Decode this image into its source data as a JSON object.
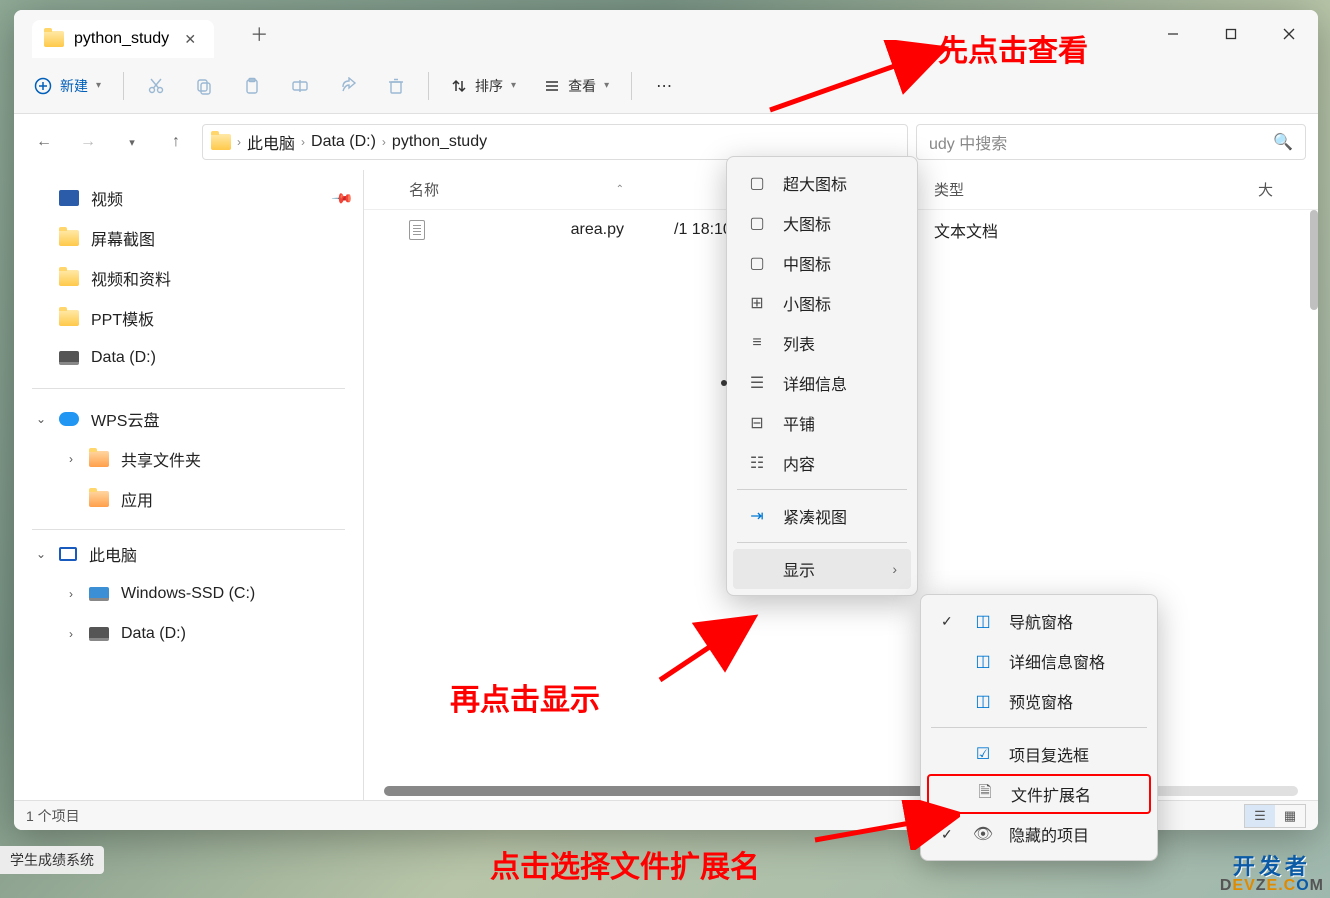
{
  "tab": {
    "title": "python_study"
  },
  "toolbar": {
    "new": "新建",
    "sort": "排序",
    "view": "查看"
  },
  "breadcrumb": {
    "b1": "此电脑",
    "b2": "Data (D:)",
    "b3": "python_study"
  },
  "search": {
    "placeholder": "udy 中搜索"
  },
  "sidebar": {
    "items": [
      "视频",
      "屏幕截图",
      "视频和资料",
      "PPT模板",
      "Data (D:)"
    ],
    "wps": "WPS云盘",
    "wps_items": [
      "共享文件夹",
      "应用"
    ],
    "thispc": "此电脑",
    "drives": [
      "Windows-SSD (C:)",
      "Data (D:)"
    ]
  },
  "columns": {
    "name": "名称",
    "date": "/1 18:10",
    "type_header": "类型",
    "size_header": "大",
    "type": "文本文档"
  },
  "file": {
    "name": "area.py"
  },
  "status": {
    "text": "1 个项目"
  },
  "menu1": {
    "items": [
      "超大图标",
      "大图标",
      "中图标",
      "小图标",
      "列表",
      "详细信息",
      "平铺",
      "内容",
      "紧凑视图",
      "显示"
    ]
  },
  "menu2": {
    "items": [
      "导航窗格",
      "详细信息窗格",
      "预览窗格",
      "项目复选框",
      "文件扩展名",
      "隐藏的项目"
    ]
  },
  "annotations": {
    "a1": "先点击查看",
    "a2": "再点击显示",
    "a3": "点击选择文件扩展名"
  },
  "taskbar": {
    "app": "学生成绩系统"
  },
  "watermark": {
    "cn": "开发者",
    "en1": "D",
    "en2": "EV",
    "en3": "Z",
    "en4": "E.C",
    "en5": "O",
    "en6": "M"
  }
}
